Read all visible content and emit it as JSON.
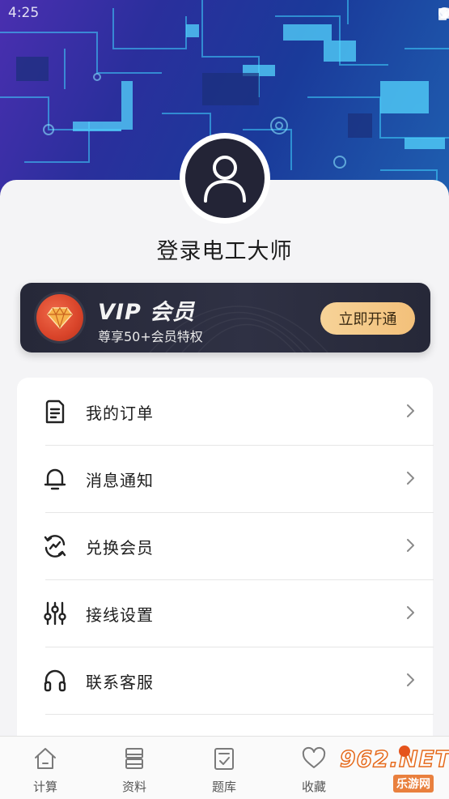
{
  "status_bar": {
    "time": "4:25"
  },
  "profile": {
    "login_prompt": "登录电工大师"
  },
  "vip": {
    "title": "VIP 会员",
    "subtitle": "尊享50+会员特权",
    "button_label": "立即开通"
  },
  "menu": {
    "items": [
      {
        "label": "我的订单",
        "icon": "order-icon"
      },
      {
        "label": "消息通知",
        "icon": "bell-icon"
      },
      {
        "label": "兑换会员",
        "icon": "exchange-icon"
      },
      {
        "label": "接线设置",
        "icon": "sliders-icon"
      },
      {
        "label": "联系客服",
        "icon": "headset-icon"
      }
    ]
  },
  "tabbar": {
    "tabs": [
      {
        "label": "计算",
        "icon": "home-icon"
      },
      {
        "label": "资料",
        "icon": "storage-icon"
      },
      {
        "label": "题库",
        "icon": "checklist-icon"
      },
      {
        "label": "收藏",
        "icon": "heart-icon"
      }
    ]
  },
  "watermark": {
    "brand": "962.NET",
    "site": "乐游网"
  },
  "colors": {
    "vip_button": "#f3c07a",
    "vip_bar": "#2a2c3d",
    "avatar_bg": "#232436",
    "badge": "#d9442a"
  }
}
